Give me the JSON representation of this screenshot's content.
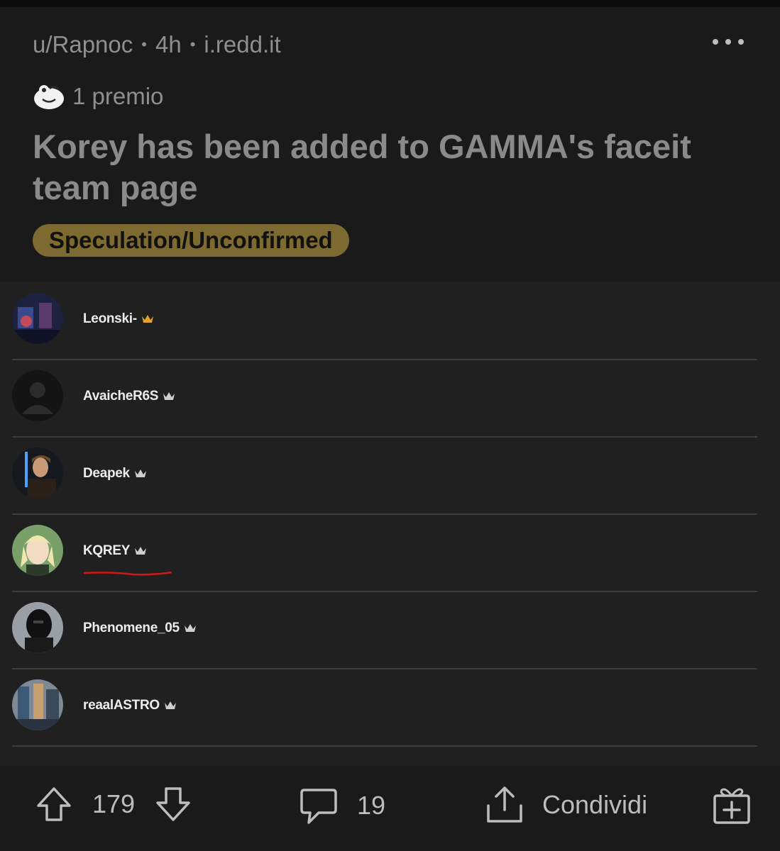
{
  "post": {
    "author": "u/Rapnoc",
    "time": "4h",
    "domain": "i.redd.it",
    "separator": "•",
    "award_count": "1 premio",
    "title": "Korey has been added to GAMMA's faceit team page",
    "flair": "Speculation/Unconfirmed"
  },
  "team": {
    "members": [
      {
        "name": "Leonski-",
        "crown_color": "#e3a32b"
      },
      {
        "name": "AvaicheR6S",
        "crown_color": "#cfcfcf"
      },
      {
        "name": "Deapek",
        "crown_color": "#cfcfcf"
      },
      {
        "name": "KQREY",
        "crown_color": "#cfcfcf",
        "underlined": true
      },
      {
        "name": "Phenomene_05",
        "crown_color": "#cfcfcf"
      },
      {
        "name": "reaalASTRO",
        "crown_color": "#cfcfcf"
      }
    ]
  },
  "actions": {
    "upvotes": "179",
    "comments": "19",
    "share_label": "Condividi"
  },
  "colors": {
    "background": "#1a1a1b",
    "image_background": "#202020",
    "flair": "#7d6a30",
    "underline": "#d01818"
  },
  "icons": [
    "more-icon",
    "award-icon",
    "crown-icon",
    "upvote-icon",
    "downvote-icon",
    "comment-icon",
    "share-icon",
    "gift-icon"
  ]
}
